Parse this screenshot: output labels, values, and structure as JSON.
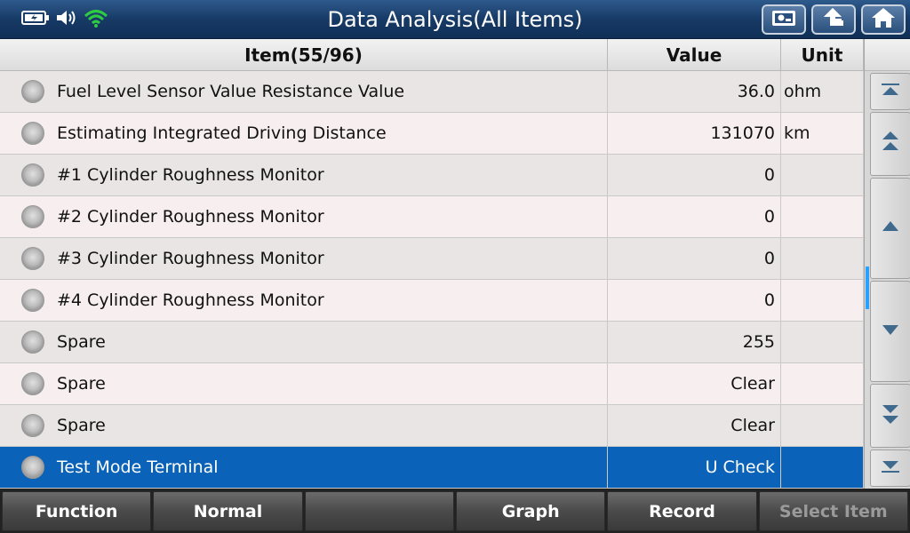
{
  "title": "Data Analysis(All Items)",
  "status_icons": [
    "battery-icon",
    "speaker-icon",
    "wifi-icon"
  ],
  "header_buttons": [
    "screenshot-icon",
    "back-icon",
    "home-icon"
  ],
  "table": {
    "columns": {
      "item": "Item(55/96)",
      "value": "Value",
      "unit": "Unit"
    },
    "rows": [
      {
        "item": "Fuel Level Sensor Value Resistance Value",
        "value": "36.0",
        "unit": "ohm",
        "selected": false
      },
      {
        "item": "Estimating Integrated Driving Distance",
        "value": "131070",
        "unit": "km",
        "selected": false
      },
      {
        "item": "#1 Cylinder Roughness Monitor",
        "value": "0",
        "unit": "",
        "selected": false
      },
      {
        "item": "#2 Cylinder Roughness Monitor",
        "value": "0",
        "unit": "",
        "selected": false
      },
      {
        "item": "#3 Cylinder Roughness Monitor",
        "value": "0",
        "unit": "",
        "selected": false
      },
      {
        "item": "#4 Cylinder Roughness Monitor",
        "value": "0",
        "unit": "",
        "selected": false
      },
      {
        "item": "Spare",
        "value": "255",
        "unit": "",
        "selected": false
      },
      {
        "item": "Spare",
        "value": "Clear",
        "unit": "",
        "selected": false
      },
      {
        "item": "Spare",
        "value": "Clear",
        "unit": "",
        "selected": false
      },
      {
        "item": "Test Mode Terminal",
        "value": "U Check",
        "unit": "",
        "selected": true
      }
    ]
  },
  "scroll_buttons": [
    "scroll-top-icon",
    "page-up-icon",
    "up-icon",
    "down-icon",
    "page-down-icon",
    "scroll-bottom-icon"
  ],
  "bottom_buttons": [
    {
      "label": "Function",
      "enabled": true
    },
    {
      "label": "Normal",
      "enabled": true
    },
    {
      "label": "",
      "enabled": true
    },
    {
      "label": "Graph",
      "enabled": true
    },
    {
      "label": "Record",
      "enabled": true
    },
    {
      "label": "Select Item",
      "enabled": false
    }
  ],
  "colors": {
    "selected_row": "#0a63b8",
    "titlebar": "#173a66",
    "scroll_indicator": "#2aa0ff"
  }
}
